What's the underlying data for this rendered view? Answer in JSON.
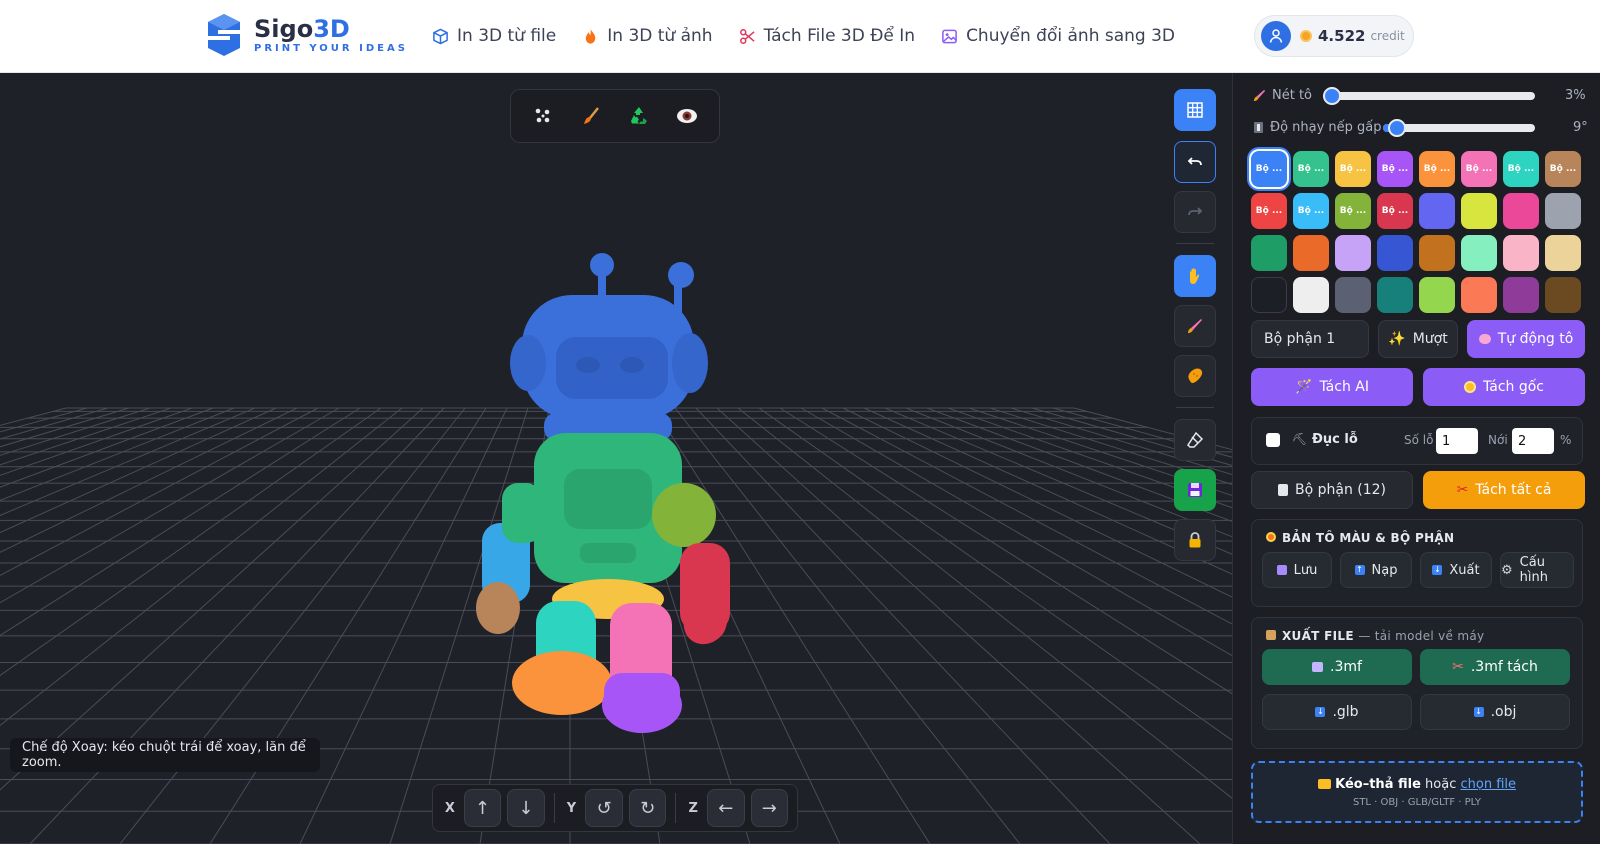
{
  "header": {
    "logo_name_a": "Sigo",
    "logo_name_b": "3D",
    "logo_tagline": "PRINT YOUR IDEAS",
    "nav": [
      {
        "label": "In 3D từ file",
        "icon": "cube-icon"
      },
      {
        "label": "In 3D từ ảnh",
        "icon": "fire-icon"
      },
      {
        "label": "Tách File 3D Để In",
        "icon": "scissors-icon"
      },
      {
        "label": "Chuyển đổi ảnh sang 3D",
        "icon": "image-icon"
      }
    ],
    "credit_value": "4.522",
    "credit_unit": "credit"
  },
  "viewport": {
    "tooltip": "Chế độ Xoay: kéo chuột trái để xoay, lăn để zoom.",
    "axis_x": "X",
    "axis_y": "Y",
    "axis_z": "Z",
    "axis_buttons": [
      "↑",
      "↓",
      "↺",
      "↻",
      "←",
      "→"
    ]
  },
  "panel": {
    "brush_label": "Nét tô",
    "brush_value": "3%",
    "brush_fraction": 0.03,
    "crease_label": "Độ nhạy nếp gấp",
    "crease_value": "9°",
    "crease_fraction": 0.09,
    "swatch_short_label": "Bộ ...",
    "swatches": [
      {
        "color": "#3b82f6",
        "label": true,
        "selected": true
      },
      {
        "color": "#34c38f",
        "label": true
      },
      {
        "color": "#f6c343",
        "label": true
      },
      {
        "color": "#a855f7",
        "label": true
      },
      {
        "color": "#fb923c",
        "label": true
      },
      {
        "color": "#f472b6",
        "label": true
      },
      {
        "color": "#2dd4bf",
        "label": true
      },
      {
        "color": "#b8845a",
        "label": true
      },
      {
        "color": "#ef4444",
        "label": true
      },
      {
        "color": "#38bdf8",
        "label": true
      },
      {
        "color": "#84b33a",
        "label": true
      },
      {
        "color": "#d9374f",
        "label": true
      },
      {
        "color": "#6366f1"
      },
      {
        "color": "#d9e53f"
      },
      {
        "color": "#ec4899"
      },
      {
        "color": "#9ca3af"
      },
      {
        "color": "#1f9d66"
      },
      {
        "color": "#ea6a2a"
      },
      {
        "color": "#c7a3f7"
      },
      {
        "color": "#3656d4"
      },
      {
        "color": "#c2711e"
      },
      {
        "color": "#86efc0"
      },
      {
        "color": "#f9b4c8"
      },
      {
        "color": "#ecd39a"
      },
      {
        "color": "#1c1f26"
      },
      {
        "color": "#eeeeee"
      },
      {
        "color": "#5b6172"
      },
      {
        "color": "#17807a"
      },
      {
        "color": "#95d64f"
      },
      {
        "color": "#fb7955"
      },
      {
        "color": "#8e3b9a"
      },
      {
        "color": "#6b4a22"
      }
    ],
    "part_name": "Bộ phận 1",
    "smooth_label": "Mượt",
    "auto_paint_label": "Tự động tô",
    "split_ai_label": "Tách AI",
    "split_original_label": "Tách gốc",
    "drill_label": "Đục lỗ",
    "hole_count_label": "Số lỗ",
    "hole_count_value": "1",
    "place_label": "Nới",
    "place_value": "2",
    "percent_label": "%",
    "parts_label": "Bộ phận (12)",
    "split_all_label": "Tách tất cả",
    "color_map_title": "BẢN TÔ MÀU & BỘ PHẬN",
    "save_label": "Lưu",
    "load_label": "Nạp",
    "export_label": "Xuất",
    "config_label": "Cấu hình",
    "export_file_title": "XUẤT FILE",
    "export_file_sub": "— tải model về máy",
    "btn_3mf": ".3mf",
    "btn_3mf_split": ".3mf tách",
    "btn_glb": ".glb",
    "btn_obj": ".obj",
    "drop_bold": "Kéo–thả file",
    "drop_or": "hoặc",
    "drop_link": "chọn file",
    "drop_formats": "STL · OBJ · GLB/GLTF · PLY"
  }
}
